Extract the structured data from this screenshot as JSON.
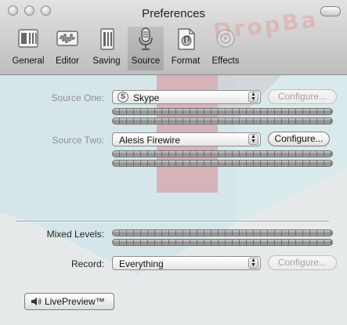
{
  "window": {
    "title": "Preferences"
  },
  "watermark": "DropBa",
  "toolbar": {
    "items": [
      {
        "label": "General",
        "icon": "general-icon"
      },
      {
        "label": "Editor",
        "icon": "editor-icon"
      },
      {
        "label": "Saving",
        "icon": "saving-icon"
      },
      {
        "label": "Source",
        "icon": "microphone-icon",
        "selected": true
      },
      {
        "label": "Format",
        "icon": "format-icon"
      },
      {
        "label": "Effects",
        "icon": "effects-icon",
        "disabled": true
      }
    ]
  },
  "source_one": {
    "label": "Source One:",
    "value": "Skype",
    "configure": "Configure..."
  },
  "source_two": {
    "label": "Source Two:",
    "value": "Alesis Firewire",
    "configure": "Configure..."
  },
  "mixed_levels": {
    "label": "Mixed Levels:"
  },
  "record": {
    "label": "Record:",
    "value": "Everything",
    "configure": "Configure..."
  },
  "live_preview": {
    "label": "LivePreview™"
  },
  "colors": {
    "accent_stripe": "#d7767e",
    "panel_bg": "#d4e6e9",
    "toolbar_bg": "#c8c8c8"
  }
}
